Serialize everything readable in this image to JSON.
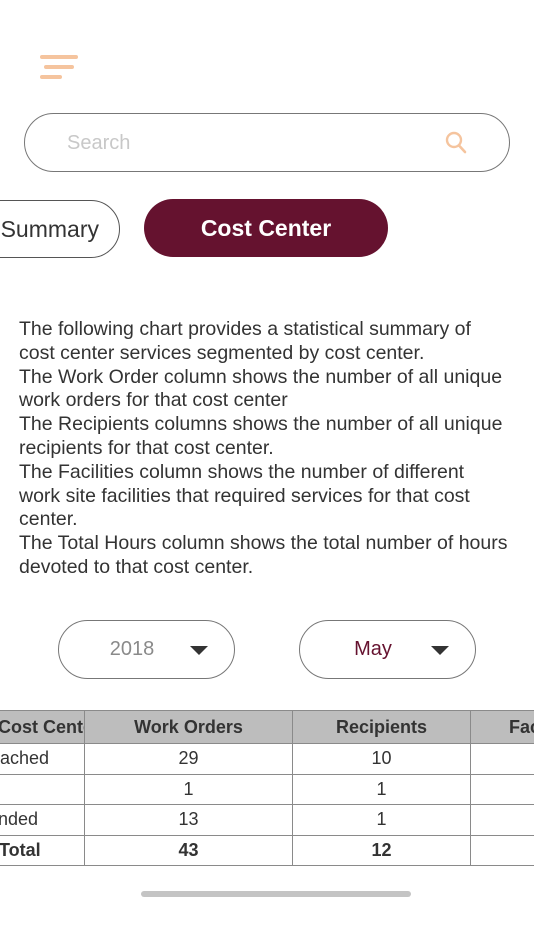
{
  "header": {
    "menu_icon": "hamburger-menu-icon"
  },
  "search": {
    "placeholder": "Search",
    "value": "",
    "icon": "search-icon",
    "icon_color": "#f5c49e"
  },
  "tabs": [
    {
      "label": "Summary",
      "active": false
    },
    {
      "label": "Cost Center",
      "active": true
    }
  ],
  "accent_color": "#65122f",
  "description": [
    "The following chart provides a statistical summary of cost center services segmented by cost center.",
    "The Work Order column shows the number of all unique work orders for that cost center",
    "The Recipients columns shows the number of all unique recipients for that cost center.",
    "The Facilities column shows the number of different work site facilities that required services for that cost center.",
    "The Total Hours column shows the total number of hours devoted to that cost center."
  ],
  "filters": {
    "year": {
      "value": "2018",
      "icon": "caret-down-icon"
    },
    "month": {
      "value": "May",
      "icon": "caret-down-icon"
    }
  },
  "table": {
    "headers": [
      "Cost Center",
      "Work Orders",
      "Recipients",
      "Facilities"
    ],
    "rows": [
      [
        "Reached",
        "29",
        "10",
        ""
      ],
      [
        "",
        "1",
        "1",
        ""
      ],
      [
        "Funded",
        "13",
        "1",
        ""
      ]
    ],
    "total": [
      "Total",
      "43",
      "12",
      ""
    ]
  }
}
